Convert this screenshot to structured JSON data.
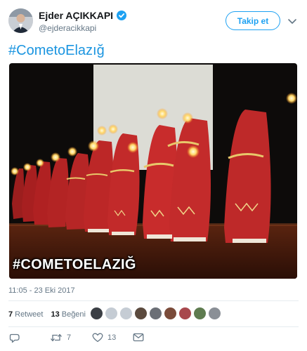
{
  "user": {
    "display_name": "Ejder AÇIKKAPI",
    "handle": "@ejderacikkapi",
    "verified_icon": "verified-badge-icon"
  },
  "follow_label": "Takip et",
  "tweet": {
    "text": "#CometoElazığ",
    "image_overlay": "#COMETOELAZIĞ",
    "timestamp": "11:05 - 23 Eki 2017"
  },
  "stats": {
    "retweet_count": "7",
    "retweet_label": "Retweet",
    "like_count": "13",
    "like_label": "Beğeni"
  },
  "actions": {
    "reply_count": "",
    "retweet_count": "7",
    "like_count": "13"
  },
  "colors": {
    "accent": "#1da1f2",
    "link": "#1b95e0",
    "muted": "#657786"
  }
}
